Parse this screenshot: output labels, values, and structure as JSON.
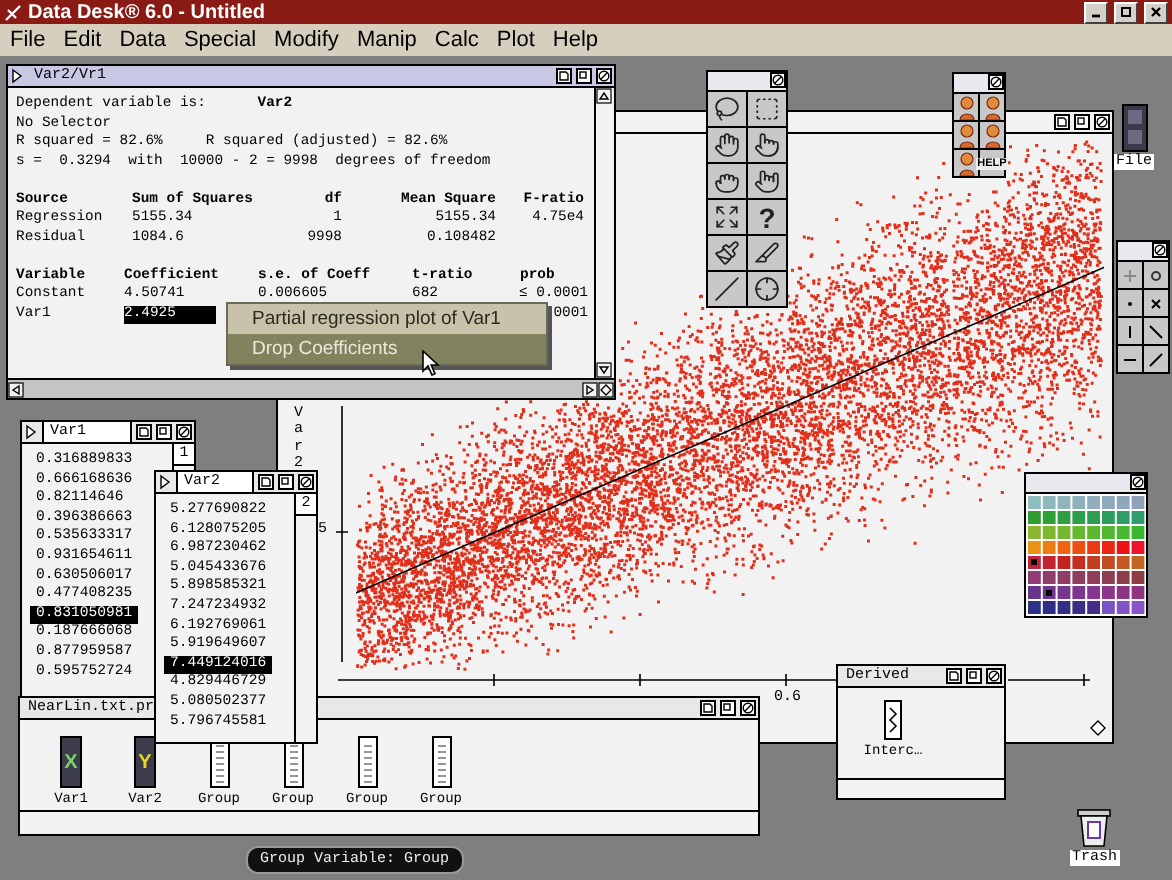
{
  "app": {
    "title": "Data Desk® 6.0 - Untitled"
  },
  "menu": [
    "File",
    "Edit",
    "Data",
    "Special",
    "Modify",
    "Manip",
    "Calc",
    "Plot",
    "Help"
  ],
  "regression_window": {
    "title": "Var2/Vr1",
    "dependent_label": "Dependent variable is:",
    "dependent_value": "Var2",
    "info_lines": [
      "No Selector",
      "R squared = 82.6%     R squared (adjusted) = 82.6%",
      "s =  0.3294  with  10000 - 2 = 9998  degrees of freedom"
    ],
    "anova": {
      "columns": [
        "Source",
        "Sum of Squares",
        "df",
        "Mean Square",
        "F-ratio"
      ],
      "rows": [
        {
          "source": "Regression",
          "sum_of_squares": "5155.34",
          "df": "1",
          "mean_square": "5155.34",
          "f_ratio": "4.75e4"
        },
        {
          "source": "Residual",
          "sum_of_squares": "1084.6",
          "df": "9998",
          "mean_square": "0.108482"
        }
      ]
    },
    "coefficients": {
      "columns": [
        "Variable",
        "Coefficient",
        "s.e. of Coeff",
        "t-ratio",
        "prob"
      ],
      "rows": [
        {
          "variable": "Constant",
          "coefficient": "4.50741",
          "se": "0.006605",
          "t_ratio": "682",
          "prob": "≤ 0.0001",
          "selected": false
        },
        {
          "variable": "Var1",
          "coefficient": "2.4925",
          "prob": "0001",
          "selected": true
        }
      ]
    }
  },
  "context_menu": [
    {
      "label": "Partial regression plot of Var1",
      "selected": false
    },
    {
      "label": "Drop Coefficients",
      "selected": true
    }
  ],
  "plot_window": {
    "y_label": "Var2",
    "x_tick_label": "0.6",
    "y_tick_label": "5"
  },
  "tool_palette": {
    "help_glyph": "?"
  },
  "help_palette": {
    "help_label": "HELP"
  },
  "file_icon": {
    "label": "File"
  },
  "var_windows": [
    {
      "title": "Var1",
      "row_badge": "1",
      "values": [
        {
          "text": "0.316889833",
          "selected": false
        },
        {
          "text": "0.666168636",
          "selected": false
        },
        {
          "text": "0.82114646",
          "selected": false
        },
        {
          "text": "0.396386663",
          "selected": false
        },
        {
          "text": "0.535633317",
          "selected": false
        },
        {
          "text": "0.931654611",
          "selected": false
        },
        {
          "text": "0.630506017",
          "selected": false
        },
        {
          "text": "0.477408235",
          "selected": false
        },
        {
          "text": "0.831050981",
          "selected": true
        },
        {
          "text": "0.187666068",
          "selected": false
        },
        {
          "text": "0.877959587",
          "selected": false
        },
        {
          "text": "0.595752724",
          "selected": false
        }
      ]
    },
    {
      "title": "Var2",
      "row_badge": "2",
      "values": [
        {
          "text": "5.277690822",
          "selected": false
        },
        {
          "text": "6.128075205",
          "selected": false
        },
        {
          "text": "6.987230462",
          "selected": false
        },
        {
          "text": "5.045433676",
          "selected": false
        },
        {
          "text": "5.898585321",
          "selected": false
        },
        {
          "text": "7.247234932",
          "selected": false
        },
        {
          "text": "6.192769061",
          "selected": false
        },
        {
          "text": "5.919649607",
          "selected": false
        },
        {
          "text": "7.449124016",
          "selected": true
        },
        {
          "text": "4.829446729",
          "selected": false
        },
        {
          "text": "5.080502377",
          "selected": false
        },
        {
          "text": "5.796745581",
          "selected": false
        }
      ]
    }
  ],
  "data_window": {
    "title": "NearLin.txt.pr",
    "variables": [
      {
        "label": "Var1",
        "kind": "x",
        "badge": "X"
      },
      {
        "label": "Var2",
        "kind": "y",
        "badge": "Y"
      },
      {
        "label": "Group",
        "kind": "group"
      },
      {
        "label": "Group",
        "kind": "group"
      },
      {
        "label": "Group",
        "kind": "group"
      },
      {
        "label": "Group",
        "kind": "group"
      }
    ]
  },
  "derived_window": {
    "title": "Derived",
    "items": [
      {
        "label": "Interc…"
      }
    ]
  },
  "status": "Group Variable: Group",
  "trash": {
    "label": "Trash"
  }
}
